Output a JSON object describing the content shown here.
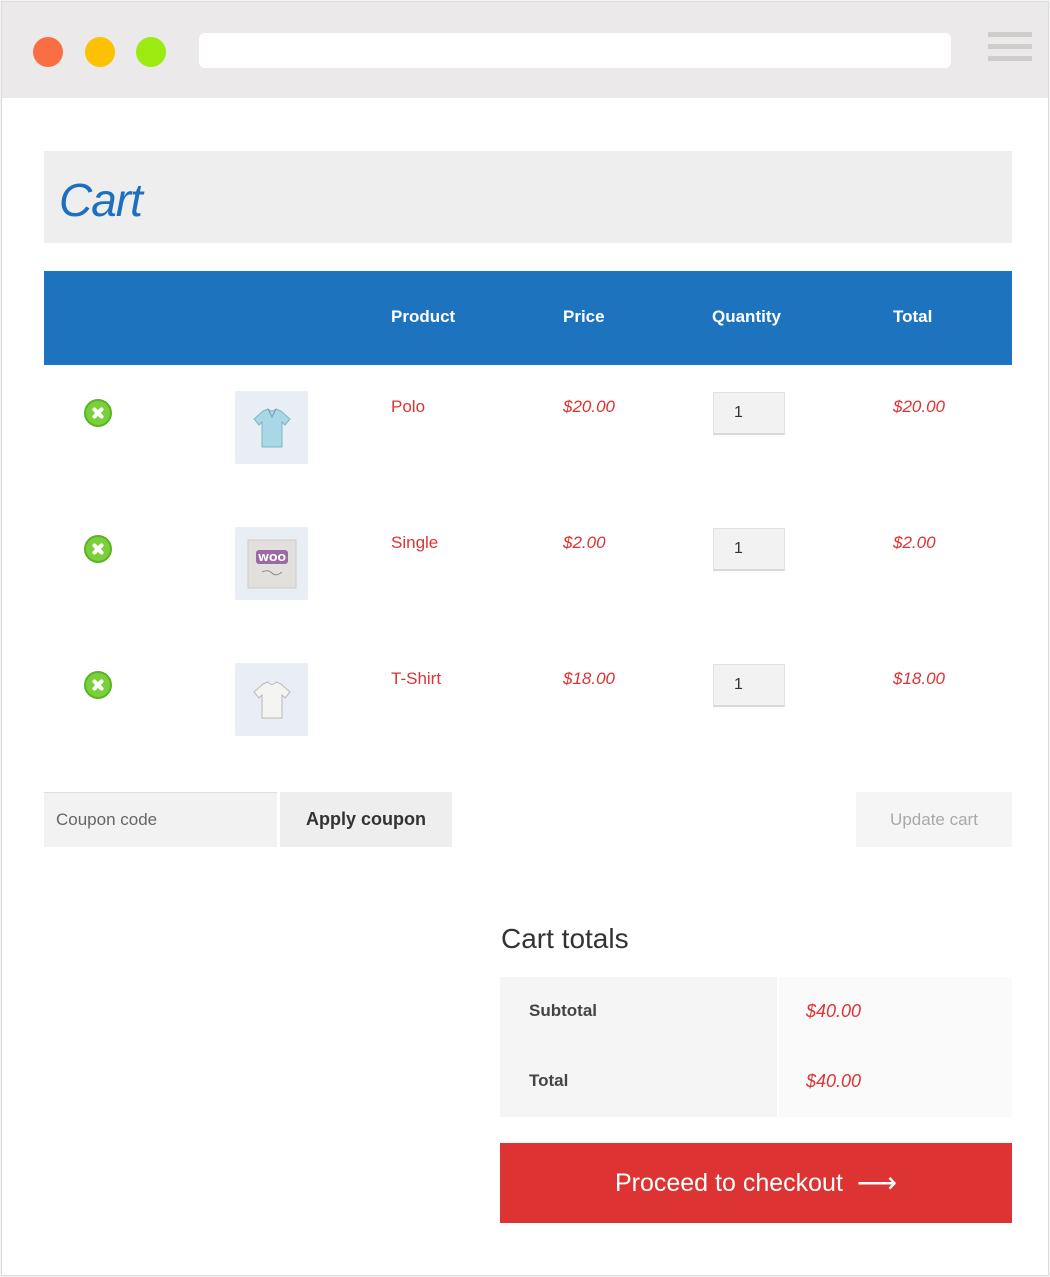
{
  "page": {
    "title": "Cart"
  },
  "table": {
    "headers": {
      "product": "Product",
      "price": "Price",
      "quantity": "Quantity",
      "total": "Total"
    },
    "rows": [
      {
        "name": "Polo",
        "price": "$20.00",
        "quantity": "1",
        "total": "$20.00",
        "thumb_icon": "polo-shirt-icon"
      },
      {
        "name": "Single",
        "price": "$2.00",
        "quantity": "1",
        "total": "$2.00",
        "thumb_icon": "woo-album-icon"
      },
      {
        "name": "T-Shirt",
        "price": "$18.00",
        "quantity": "1",
        "total": "$18.00",
        "thumb_icon": "tshirt-icon"
      }
    ]
  },
  "actions": {
    "coupon_placeholder": "Coupon code",
    "apply_coupon": "Apply coupon",
    "update_cart": "Update cart"
  },
  "totals": {
    "heading": "Cart totals",
    "subtotal_label": "Subtotal",
    "subtotal_value": "$40.00",
    "total_label": "Total",
    "total_value": "$40.00"
  },
  "checkout": {
    "label": "Proceed to checkout",
    "arrow": "⟶"
  },
  "colors": {
    "accent_blue": "#1e73be",
    "price_red": "#dd3333",
    "remove_green": "#7ad03a",
    "checkout_red": "#dd3333"
  }
}
